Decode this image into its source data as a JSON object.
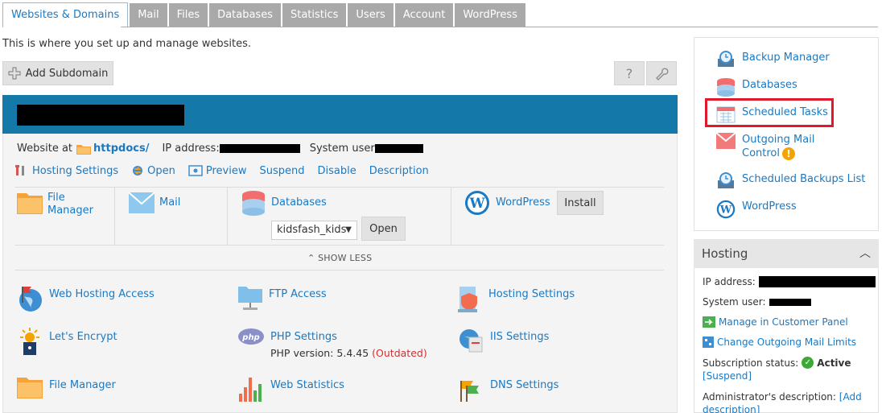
{
  "tabs": [
    "Websites & Domains",
    "Mail",
    "Files",
    "Databases",
    "Statistics",
    "Users",
    "Account",
    "WordPress"
  ],
  "intro": "This is where you set up and manage websites.",
  "toolbar": {
    "add_subdomain": "Add Subdomain",
    "help": "?"
  },
  "website": {
    "website_at_label": "Website at",
    "docroot": "httpdocs/",
    "ip_label": "IP address:",
    "system_user_label": "System user"
  },
  "actions": [
    "Hosting Settings",
    "Open",
    "Preview",
    "Suspend",
    "Disable",
    "Description"
  ],
  "tiles": {
    "file_manager": "File Manager",
    "mail": "Mail",
    "databases": "Databases",
    "db_selected": "kidsfash_kids",
    "db_open": "Open",
    "wordpress": "WordPress",
    "install": "Install"
  },
  "show_less": "SHOW LESS",
  "services": {
    "web_hosting_access": "Web Hosting Access",
    "ftp_access": "FTP Access",
    "hosting_settings": "Hosting Settings",
    "lets_encrypt": "Let's Encrypt",
    "php_settings": "PHP Settings",
    "php_version_label": "PHP version: 5.4.45",
    "php_outdated": "(Outdated)",
    "iis_settings": "IIS Settings",
    "file_manager": "File Manager",
    "web_statistics": "Web Statistics",
    "dns_settings": "DNS Settings"
  },
  "sidebar": {
    "items": [
      "Backup Manager",
      "Databases",
      "Scheduled Tasks",
      "Outgoing Mail Control",
      "Scheduled Backups List",
      "WordPress"
    ]
  },
  "hosting": {
    "title": "Hosting",
    "ip_label": "IP address:",
    "system_user_label": "System user:",
    "manage_link": "Manage in Customer Panel",
    "change_mail_link": "Change Outgoing Mail Limits",
    "subscription_label": "Subscription status:",
    "subscription_value": "Active",
    "suspend_link": "[Suspend]",
    "admin_desc_label": "Administrator's description:",
    "admin_desc_link": "[Add description]"
  },
  "colors": {
    "accent": "#1a79c3",
    "header_bar": "#1479a8",
    "highlight": "#e0182c",
    "warning": "#f5a300",
    "active": "#3aa935"
  }
}
